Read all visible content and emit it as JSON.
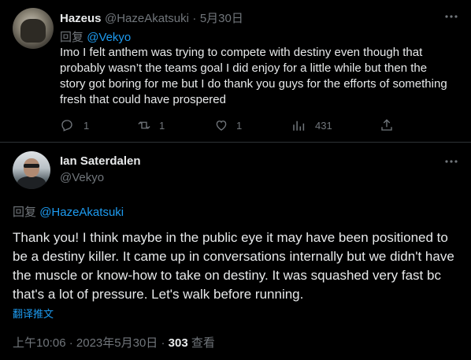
{
  "reply_tweet": {
    "name": "Hazeus",
    "handle": "@HazeAkatsuki",
    "separator": "·",
    "date": "5月30日",
    "reply_prefix": "回复",
    "reply_to": "@Vekyo",
    "text": "Imo I felt anthem was trying to compete with destiny even though that probably wasn’t the teams goal I did enjoy for a little while but then the story got boring for me but I do thank you guys for the efforts of something fresh that could have prospered",
    "stats": {
      "replies": "1",
      "retweets": "1",
      "likes": "1",
      "views": "431"
    },
    "icons": {
      "reply": "reply-icon",
      "retweet": "retweet-icon",
      "like": "heart-icon",
      "views": "views-icon",
      "share": "share-icon",
      "more": "more-icon"
    }
  },
  "main_tweet": {
    "name": "Ian Saterdalen",
    "handle": "@Vekyo",
    "reply_prefix": "回复",
    "reply_to": "@HazeAkatsuki",
    "text": "Thank you! I think maybe in the public eye it may have been positioned to be a destiny killer. It came up in conversations internally but we didn't have the muscle or know-how to take on destiny. It was squashed very fast bc that's a lot of pressure. Let's walk before running.",
    "translate_label": "翻译推文",
    "time": "上午10:06",
    "separator1": "·",
    "date": "2023年5月30日",
    "separator2": "·",
    "views_count": "303",
    "views_label": "查看"
  },
  "colors": {
    "background": "#000000",
    "text": "#e7e9ea",
    "muted": "#71767b",
    "link": "#1d9bf0",
    "divider": "#2f3336"
  }
}
